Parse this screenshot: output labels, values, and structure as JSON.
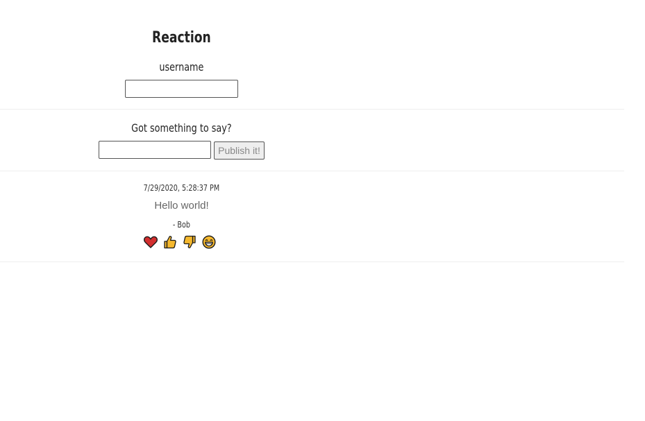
{
  "app": {
    "title": "Reaction"
  },
  "login": {
    "username_label": "username",
    "username_value": ""
  },
  "compose": {
    "prompt": "Got something to say?",
    "message_value": "",
    "publish_label": "Publish it!"
  },
  "posts": [
    {
      "timestamp": "7/29/2020, 5:28:37 PM",
      "text": "Hello world!",
      "author": "- Bob",
      "reactions": [
        {
          "icon": "heart-icon",
          "color": "#d22f2f"
        },
        {
          "icon": "thumbs-up-icon",
          "color": "#f5b82e"
        },
        {
          "icon": "thumbs-down-icon",
          "color": "#f5b82e"
        },
        {
          "icon": "laughing-face-icon",
          "color": "#f5b82e"
        }
      ]
    }
  ]
}
